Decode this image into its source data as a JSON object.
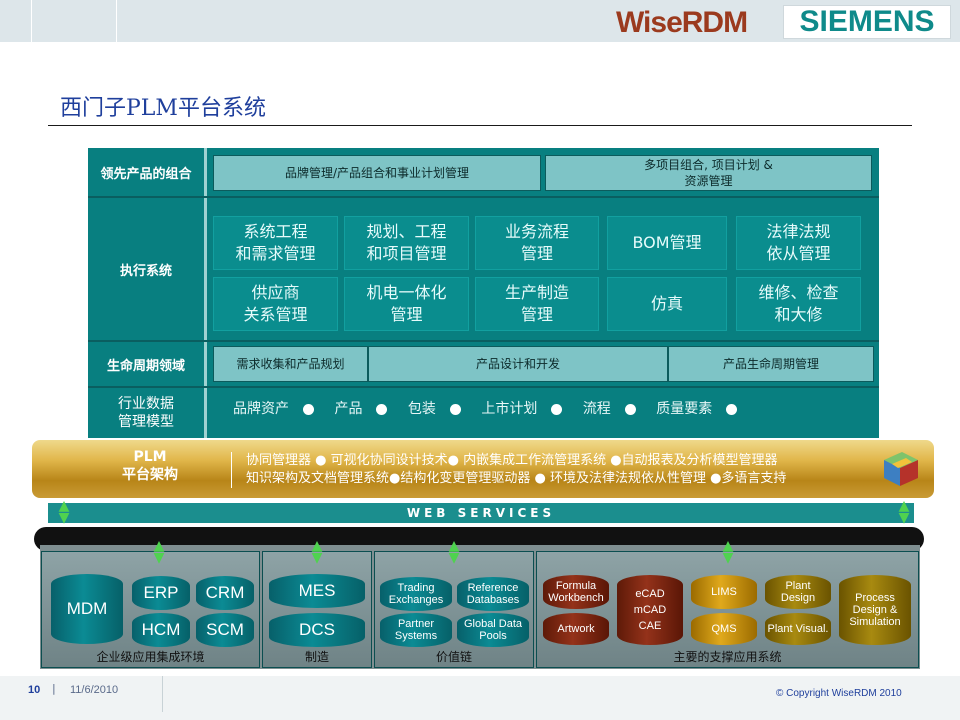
{
  "brand": {
    "wise": "WiseRDM",
    "siemens": "SIEMENS"
  },
  "page_title": "西门子PLM平台系统",
  "rows": {
    "portfolio": {
      "label": "领先产品的组合",
      "cells": [
        "品牌管理/产品组合和事业计划管理",
        "多项目组合, 项目计划 &\n资源管理"
      ]
    },
    "execution": {
      "label": "执行系统",
      "cells": [
        "系统工程\n和需求管理",
        "规划、工程\n和项目管理",
        "业务流程\n管理",
        "BOM管理",
        "法律法规\n依从管理",
        "供应商\n关系管理",
        "机电一体化\n管理",
        "生产制造\n管理",
        "仿真",
        "维修、检查\n和大修"
      ]
    },
    "lifecycle": {
      "label": "生命周期领域",
      "cells": [
        "需求收集和产品规划",
        "产品设计和开发",
        "产品生命周期管理"
      ]
    },
    "datamodel": {
      "label": "行业数据\n管理模型",
      "items": [
        "品牌资产",
        "产品",
        "包装",
        "上市计划",
        "流程",
        "质量要素"
      ]
    }
  },
  "plm": {
    "title": "PLM\n平台架构",
    "line1": "协同管理器 ● 可视化协同设计技术● 内嵌集成工作流管理系统 ●自动报表及分析模型管理器",
    "line2": "知识架构及文档管理系统●结构化变更管理驱动器 ● 环境及法律法规依从性管理 ●多语言支持"
  },
  "web_services": "WEB SERVICES",
  "segments": {
    "enterprise": {
      "label": "企业级应用集成环境",
      "items": [
        "MDM",
        "ERP",
        "CRM",
        "HCM",
        "SCM"
      ]
    },
    "manufacturing": {
      "label": "制造",
      "items": [
        "MES",
        "DCS"
      ]
    },
    "value_chain": {
      "label": "价值链",
      "items": [
        "Trading\nExchanges",
        "Reference\nDatabases",
        "Partner\nSystems",
        "Global Data\nPools"
      ]
    },
    "support": {
      "label": "主要的支撑应用系统",
      "items": [
        "Formula\nWorkbench",
        "Artwork",
        "eCAD\nmCAD\nCAE",
        "LIMS",
        "QMS",
        "Plant\nDesign",
        "Plant Visual.",
        "Process\nDesign &\nSimulation"
      ]
    }
  },
  "footer": {
    "page": "10",
    "date": "11/6/2010",
    "copyright": "© Copyright  WiseRDM 2010"
  },
  "colors": {
    "teal": "#087f80",
    "gold_bar": "#d9a93a",
    "title_blue": "#1f3f9c"
  }
}
